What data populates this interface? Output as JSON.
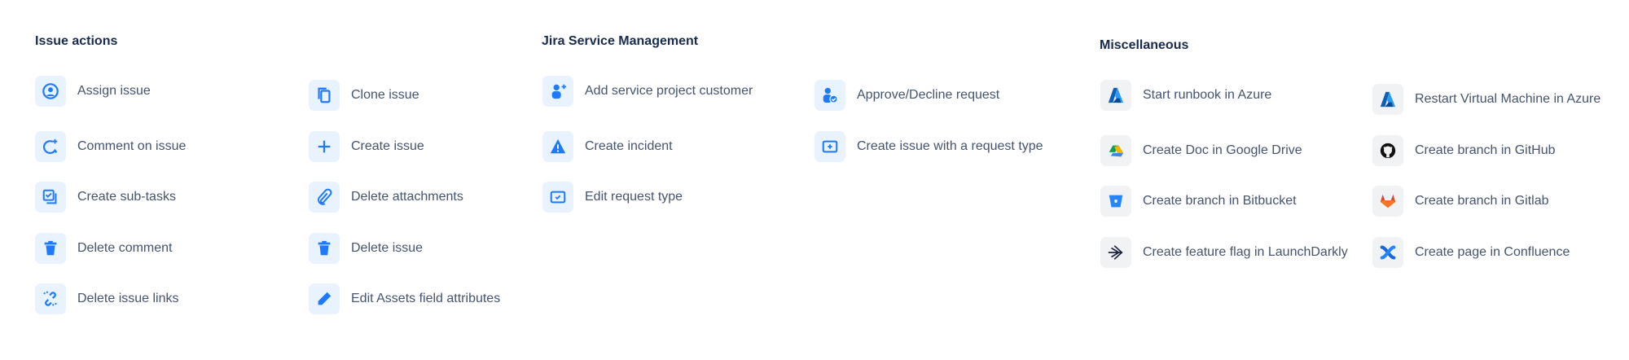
{
  "sections": {
    "issue_actions": {
      "title": "Issue actions",
      "items": [
        "Assign issue",
        "Comment on issue",
        "Create sub-tasks",
        "Delete comment",
        "Delete issue links",
        "Clone issue",
        "Create issue",
        "Delete attachments",
        "Delete issue",
        "Edit Assets field attributes"
      ]
    },
    "jsm": {
      "title": "Jira Service Management",
      "items": [
        "Add service project customer",
        "Create incident",
        "Edit request type",
        "Approve/Decline request",
        "Create issue with a request type"
      ]
    },
    "misc": {
      "title": "Miscellaneous",
      "items": [
        "Start runbook in Azure",
        "Create Doc in Google Drive",
        "Create branch in Bitbucket",
        "Create feature flag in LaunchDarkly",
        "Restart Virtual Machine in Azure",
        "Create branch in GitHub",
        "Create branch in Gitlab",
        "Create page in Confluence"
      ]
    }
  },
  "colors": {
    "accent": "#1d7afc",
    "heading": "#172b4d",
    "text": "#44546f"
  }
}
